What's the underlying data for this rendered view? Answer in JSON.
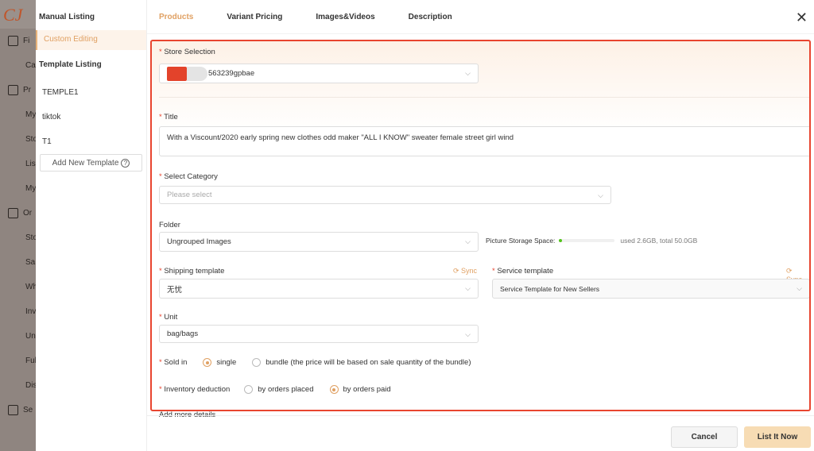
{
  "app_nav": {
    "logo": "CJ",
    "items": [
      "Fi",
      "Ca",
      "Pr",
      "My",
      "Sto",
      "Lis",
      "My",
      "Or",
      "Sto",
      "Sa",
      "Wh",
      "Inv",
      "Un",
      "Ful",
      "Dis",
      "Se"
    ]
  },
  "sidebar": {
    "manual": "Manual Listing",
    "custom": "Custom Editing",
    "template_heading": "Template Listing",
    "templates": [
      "TEMPLE1",
      "tiktok",
      "T1"
    ],
    "add": "Add New Template",
    "help": "?"
  },
  "tabs": [
    "Products",
    "Variant Pricing",
    "Images&Videos",
    "Description"
  ],
  "form": {
    "store": {
      "label": "Store Selection",
      "value": "563239gpbae"
    },
    "title": {
      "label": "Title",
      "value": "With a Viscount/2020 early spring new clothes odd maker \"ALL I KNOW\" sweater female street girl wind"
    },
    "category": {
      "label": "Select Category",
      "placeholder": "Please select"
    },
    "folder": {
      "label": "Folder",
      "value": "Ungrouped Images",
      "storage_label": "Picture Storage Space:",
      "storage_text": "used 2.6GB, total 50.0GB",
      "storage_used_fraction": 0.052
    },
    "shipping": {
      "label": "Shipping template",
      "value": "无忧",
      "sync": "Sync"
    },
    "service": {
      "label": "Service template",
      "value": "Service Template for New Sellers",
      "sync": "Sync"
    },
    "unit": {
      "label": "Unit",
      "value": "bag/bags"
    },
    "sold_in": {
      "label": "Sold in",
      "options": [
        "single",
        "bundle (the price will be based on sale quantity of the bundle)"
      ],
      "selected": 0
    },
    "inventory": {
      "label": "Inventory deduction",
      "options": [
        "by orders placed",
        "by orders paid"
      ],
      "selected": 1
    },
    "more": "Add more details"
  },
  "footer": {
    "cancel": "Cancel",
    "list": "List It Now"
  },
  "colors": {
    "accent": "#e0a062",
    "highlight": "#e8452f",
    "primary_button": "#f7dcb4"
  }
}
